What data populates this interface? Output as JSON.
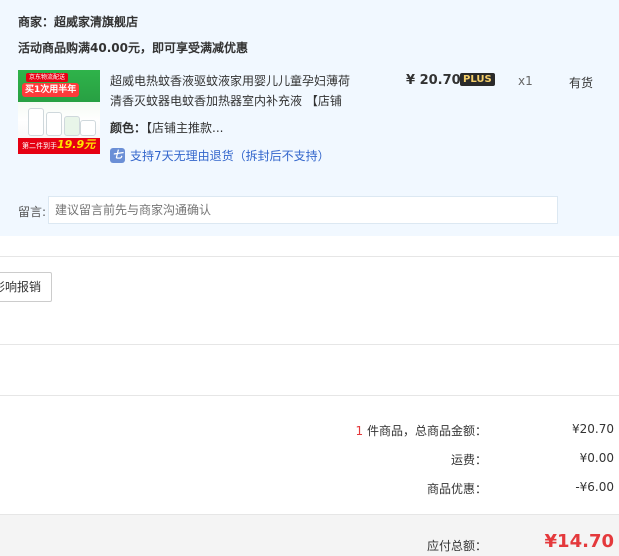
{
  "shop": {
    "label": "商家：",
    "name": "超威家清旗舰店",
    "promo": "活动商品购满40.00元，即可享受满减优惠"
  },
  "thumb": {
    "badge_small": "京东物流配送",
    "badge_big": "买1次用半年",
    "bottom_text": "第二件到手",
    "bottom_price": "19.9元"
  },
  "item": {
    "title": "超威电热蚊香液驱蚊液家用婴儿儿童孕妇薄荷清香灭蚊器电蚊香加热器室内补充液 【店铺",
    "color_label": "颜色：",
    "color_value": "【店铺主推款...",
    "return_icon": "七",
    "return_text": "支持7天无理由退货（拆封后不支持）",
    "price": "¥ 20.70",
    "plus_badge": "PLUS",
    "qty": "x1",
    "stock": "有货"
  },
  "note": {
    "label": "留言:",
    "placeholder": "建议留言前先与商家沟通确认"
  },
  "reimburse_button": "影响报销",
  "summary": {
    "count": "1",
    "count_suffix": " 件商品，总商品金额：",
    "goods_value": "¥20.70",
    "shipping_label": "运费：",
    "shipping_value": "¥0.00",
    "discount_label": "商品优惠：",
    "discount_value": "-¥6.00",
    "total_label": "应付总额：",
    "total_value": "¥14.70"
  },
  "colors": {
    "panel_bg": "#f1f8ff",
    "accent_red": "#e4393c",
    "link_blue": "#3366cc"
  }
}
